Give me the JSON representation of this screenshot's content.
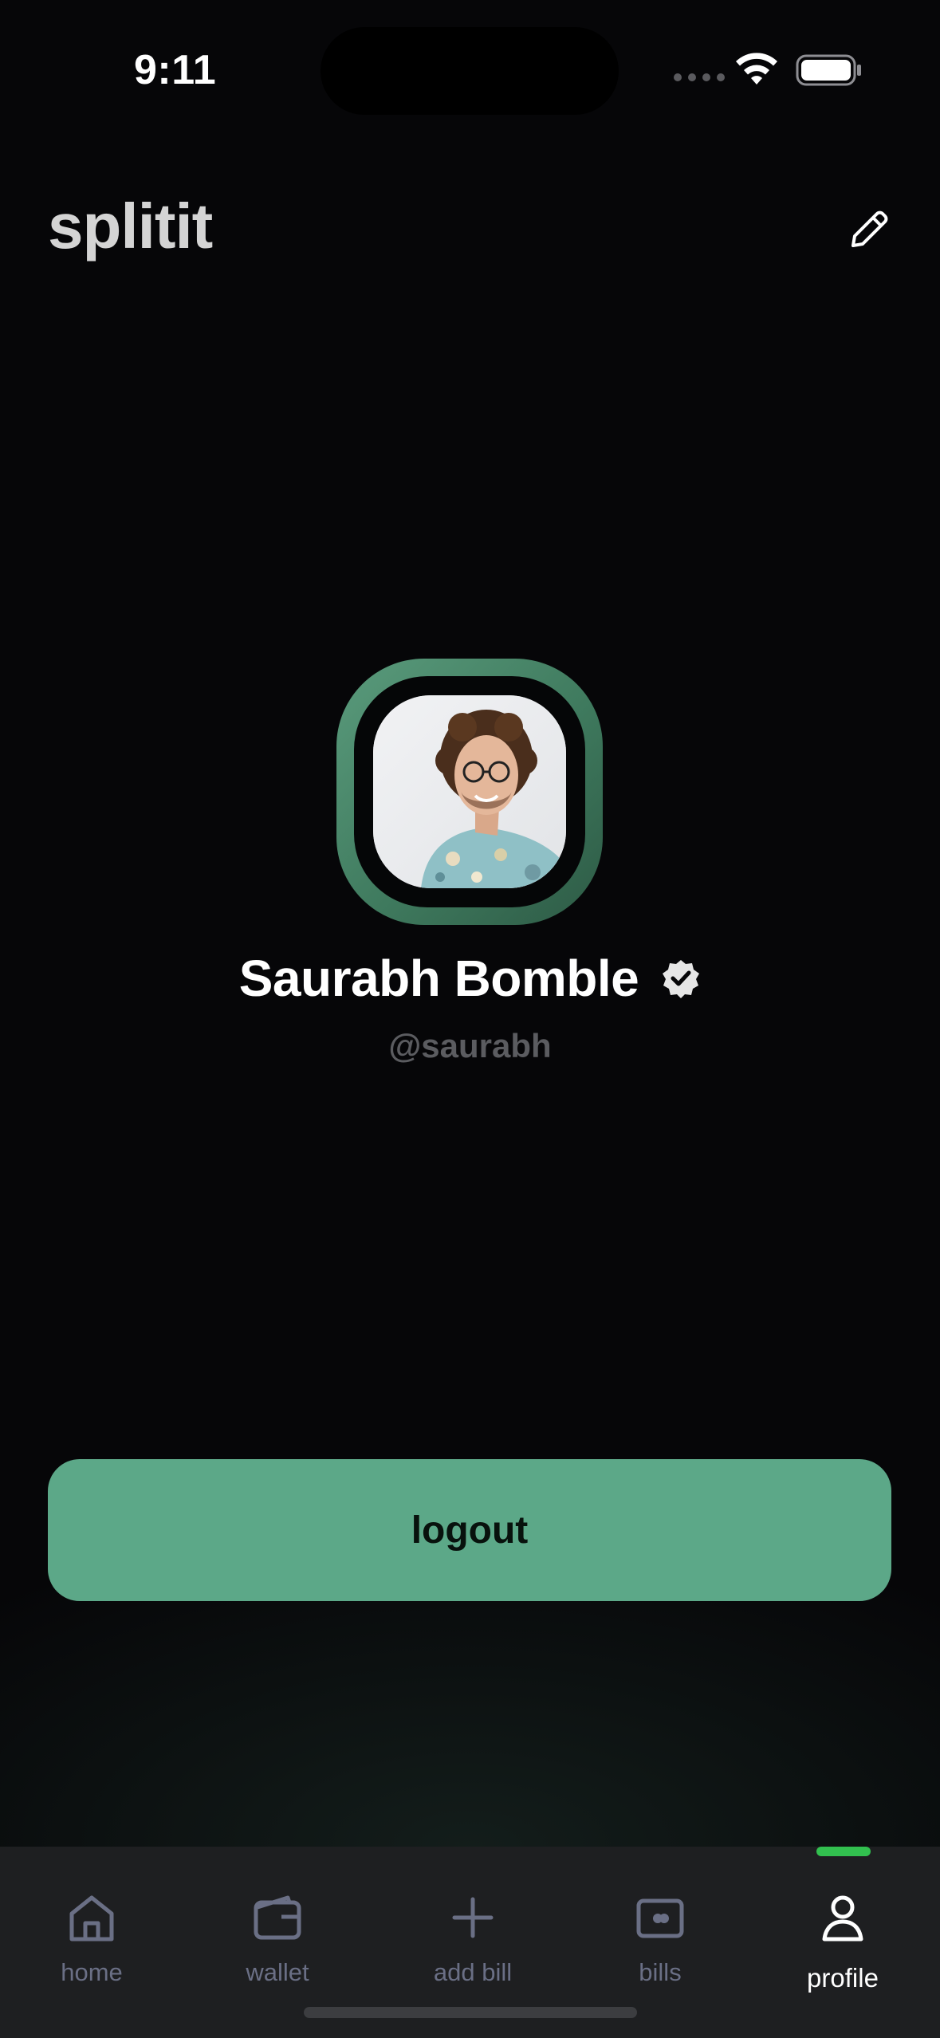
{
  "status_bar": {
    "time": "9:11"
  },
  "header": {
    "app_title": "splitit"
  },
  "profile": {
    "name": "Saurabh Bomble",
    "handle": "@saurabh",
    "verified": true
  },
  "actions": {
    "logout_label": "logout"
  },
  "tabs": [
    {
      "label": "home",
      "icon": "home-icon",
      "active": false
    },
    {
      "label": "wallet",
      "icon": "wallet-icon",
      "active": false
    },
    {
      "label": "add bill",
      "icon": "plus-icon",
      "active": false
    },
    {
      "label": "bills",
      "icon": "bills-icon",
      "active": false
    },
    {
      "label": "profile",
      "icon": "user-icon",
      "active": true
    }
  ],
  "colors": {
    "background": "#060608",
    "accent": "#5ca888",
    "tab_active_indicator": "#32c04f",
    "tab_bar": "#1e1f21",
    "tab_inactive": "#6a6f85"
  }
}
